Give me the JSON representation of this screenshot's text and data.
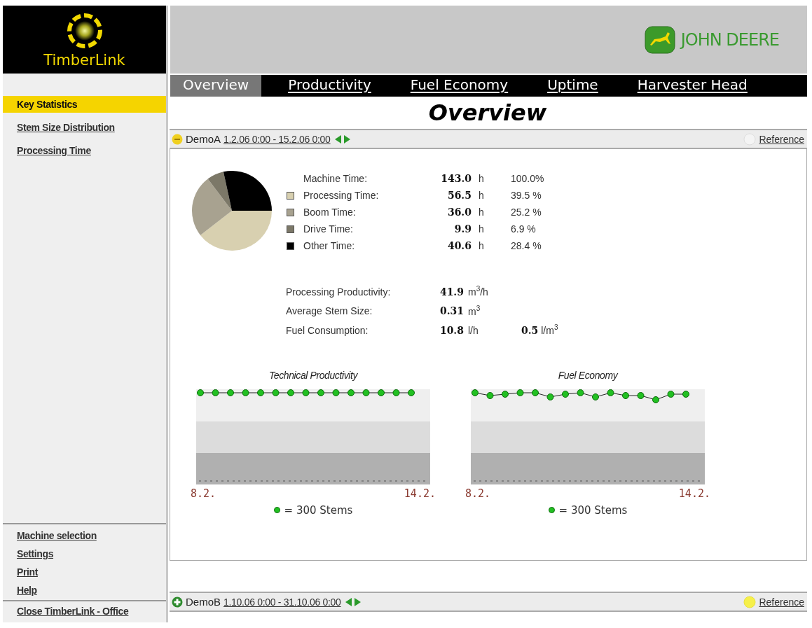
{
  "app": {
    "name": "TimberLink",
    "brand": "JOHN DEERE"
  },
  "sidebar": {
    "items": [
      {
        "label": "Key Statistics",
        "selected": true
      },
      {
        "label": "Stem Size Distribution",
        "selected": false
      },
      {
        "label": "Processing Time",
        "selected": false
      }
    ],
    "footer_items": [
      "Machine selection",
      "Settings",
      "Print",
      "Help"
    ],
    "close_item": "Close TimberLink - Office"
  },
  "tabs": [
    {
      "label": "Overview",
      "selected": true
    },
    {
      "label": "Productivity",
      "selected": false
    },
    {
      "label": "Fuel Economy",
      "selected": false
    },
    {
      "label": "Uptime",
      "selected": false
    },
    {
      "label": "Harvester Head",
      "selected": false
    }
  ],
  "page_title": "Overview",
  "machines": [
    {
      "name": "DemoA",
      "range": "1.2.06 0:00 - 15.2.06 0:00",
      "expanded": true,
      "reference": "Reference",
      "reference_on": false
    },
    {
      "name": "DemoB",
      "range": "1.10.06 0:00 - 31.10.06 0:00",
      "expanded": false,
      "reference": "Reference",
      "reference_on": true
    }
  ],
  "time_rows": [
    {
      "kind": "total",
      "label": "Machine Time:",
      "value": "143.0",
      "unit": "h",
      "share": "100.0%"
    },
    {
      "kind": "part",
      "label": "Processing Time:",
      "value": "56.5",
      "unit": "h",
      "share": "39.5 %",
      "color": "#d8d0b0"
    },
    {
      "kind": "part",
      "label": "Boom Time:",
      "value": "36.0",
      "unit": "h",
      "share": "25.2 %",
      "color": "#a8a290"
    },
    {
      "kind": "part",
      "label": "Drive Time:",
      "value": "9.9",
      "unit": "h",
      "share": "6.9 %",
      "color": "#7c7868"
    },
    {
      "kind": "part",
      "label": "Other Time:",
      "value": "40.6",
      "unit": "h",
      "share": "28.4 %",
      "color": "#000000"
    }
  ],
  "pie": {
    "chart_data": {
      "type": "pie",
      "values": [
        39.5,
        25.2,
        6.9,
        28.4
      ]
    }
  },
  "key_figures": [
    {
      "label": "Processing Productivity:",
      "value": "41.9",
      "unit": "m$^{3}$/h"
    },
    {
      "label": "Average Stem Size:",
      "value": "0.31",
      "unit": "m$^{3}$"
    },
    {
      "label": "Fuel Consumption:",
      "value": "10.8",
      "unit": "l/h",
      "value_2": "0.5",
      "unit_2": "l/m$^{3}$"
    }
  ],
  "trends": [
    {
      "title": "Technical Productivity",
      "start": "8.2.",
      "end": "14.2.",
      "legend": "= 300 Stems"
    },
    {
      "title": "Fuel Economy",
      "start": "8.2.",
      "end": "14.2.",
      "legend": "= 300 Stems"
    }
  ]
}
